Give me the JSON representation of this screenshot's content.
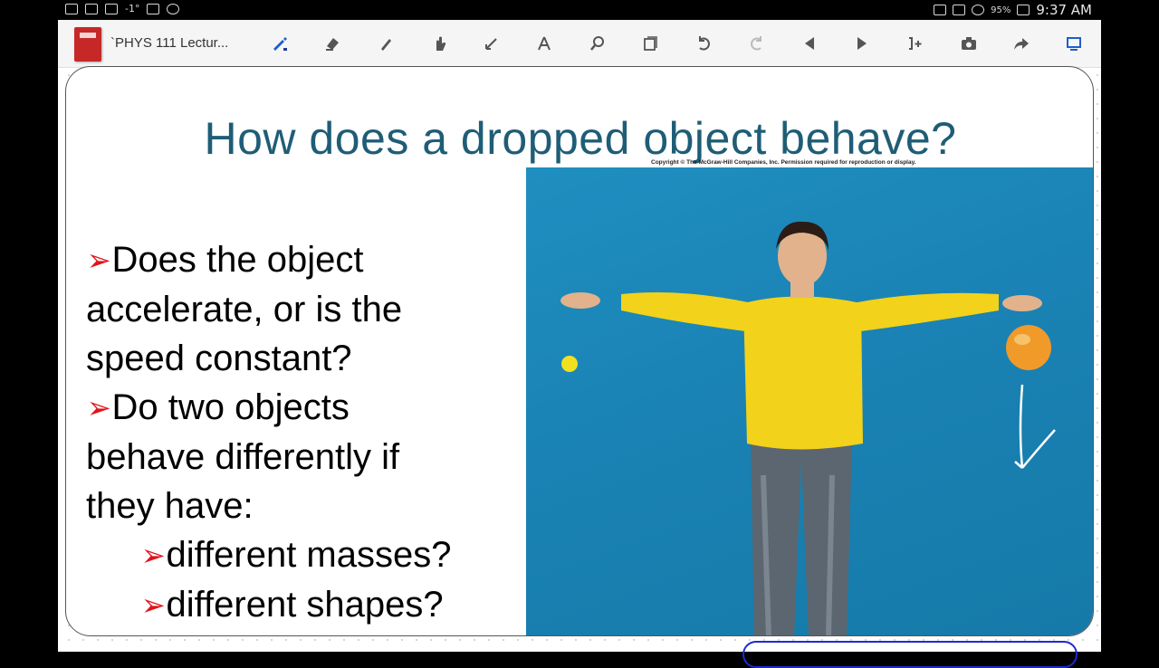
{
  "status_bar": {
    "signal_text": "-1°",
    "battery": "95%",
    "time": "9:37 AM"
  },
  "toolbar": {
    "document_title": "`PHYS 111 Lectur...",
    "tools": [
      "pen-icon",
      "eraser-icon",
      "highlighter-icon",
      "hand-icon",
      "line-icon",
      "shape-icon",
      "search-icon",
      "page-nav-icon",
      "undo-icon",
      "redo-icon",
      "previous-page-icon",
      "next-page-icon",
      "insert-page-icon",
      "camera-icon",
      "share-icon",
      "present-icon"
    ]
  },
  "slide": {
    "title": "How does a dropped object behave?",
    "copyright": "Copyright © The McGraw-Hill Companies, Inc. Permission required for reproduction or display.",
    "bullets": [
      {
        "line1": "Does the object",
        "line2": "accelerate, or is the",
        "line3": "speed constant?"
      },
      {
        "line1": "Do two objects",
        "line2": "behave differently if",
        "line3": "they have:"
      }
    ],
    "sub_bullets": [
      "different masses?",
      "different shapes?"
    ],
    "arrow_glyph": "➢"
  },
  "colors": {
    "title": "#1f5d76",
    "bullet_arrow": "#e0141a",
    "photo_background": "#1a86b8",
    "sweater": "#f2d21b",
    "ink": "#1a2bd0",
    "active_tool": "#1e5fc9"
  }
}
